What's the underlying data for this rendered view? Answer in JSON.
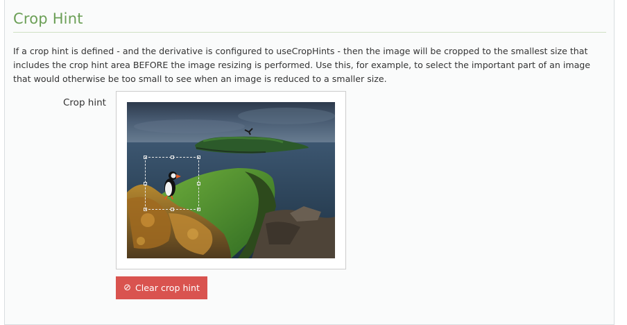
{
  "section": {
    "title": "Crop Hint",
    "description": "If a crop hint is defined - and the derivative is configured to useCropHints - then the image will be cropped to the smallest size that includes the crop hint area BEFORE the image resizing is performed. Use this, for example, to select the important part of an image that would otherwise be too small to see when an image is reduced to a smaller size."
  },
  "field": {
    "label": "Crop hint"
  },
  "image": {
    "icon": "landscape-photo-puffin"
  },
  "clear_button": {
    "label": "Clear crop hint",
    "icon": "ban-icon",
    "icon_glyph": "⊘",
    "color": "#d9534f"
  },
  "colors": {
    "title": "#6b9f56",
    "text": "#333333"
  }
}
